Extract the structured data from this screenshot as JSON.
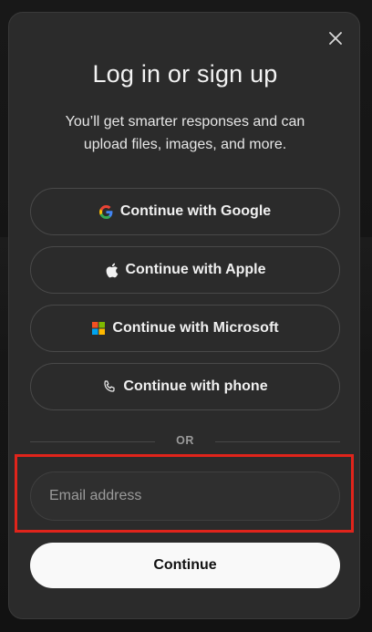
{
  "modal": {
    "title": "Log in or sign up",
    "subtitle": "You’ll get smarter responses and can upload files, images, and more.",
    "close_icon": "close-icon"
  },
  "auth_options": [
    {
      "label": "Continue with Google",
      "icon": "google-icon"
    },
    {
      "label": "Continue with Apple",
      "icon": "apple-icon"
    },
    {
      "label": "Continue with Microsoft",
      "icon": "microsoft-icon"
    },
    {
      "label": "Continue with phone",
      "icon": "phone-icon"
    }
  ],
  "divider": {
    "label": "OR"
  },
  "email": {
    "value": "",
    "placeholder": "Email address"
  },
  "continue_button": {
    "label": "Continue"
  },
  "colors": {
    "modal_bg": "#2b2b2b",
    "highlight": "#e0241b",
    "primary_button_bg": "#f9f9f9"
  }
}
